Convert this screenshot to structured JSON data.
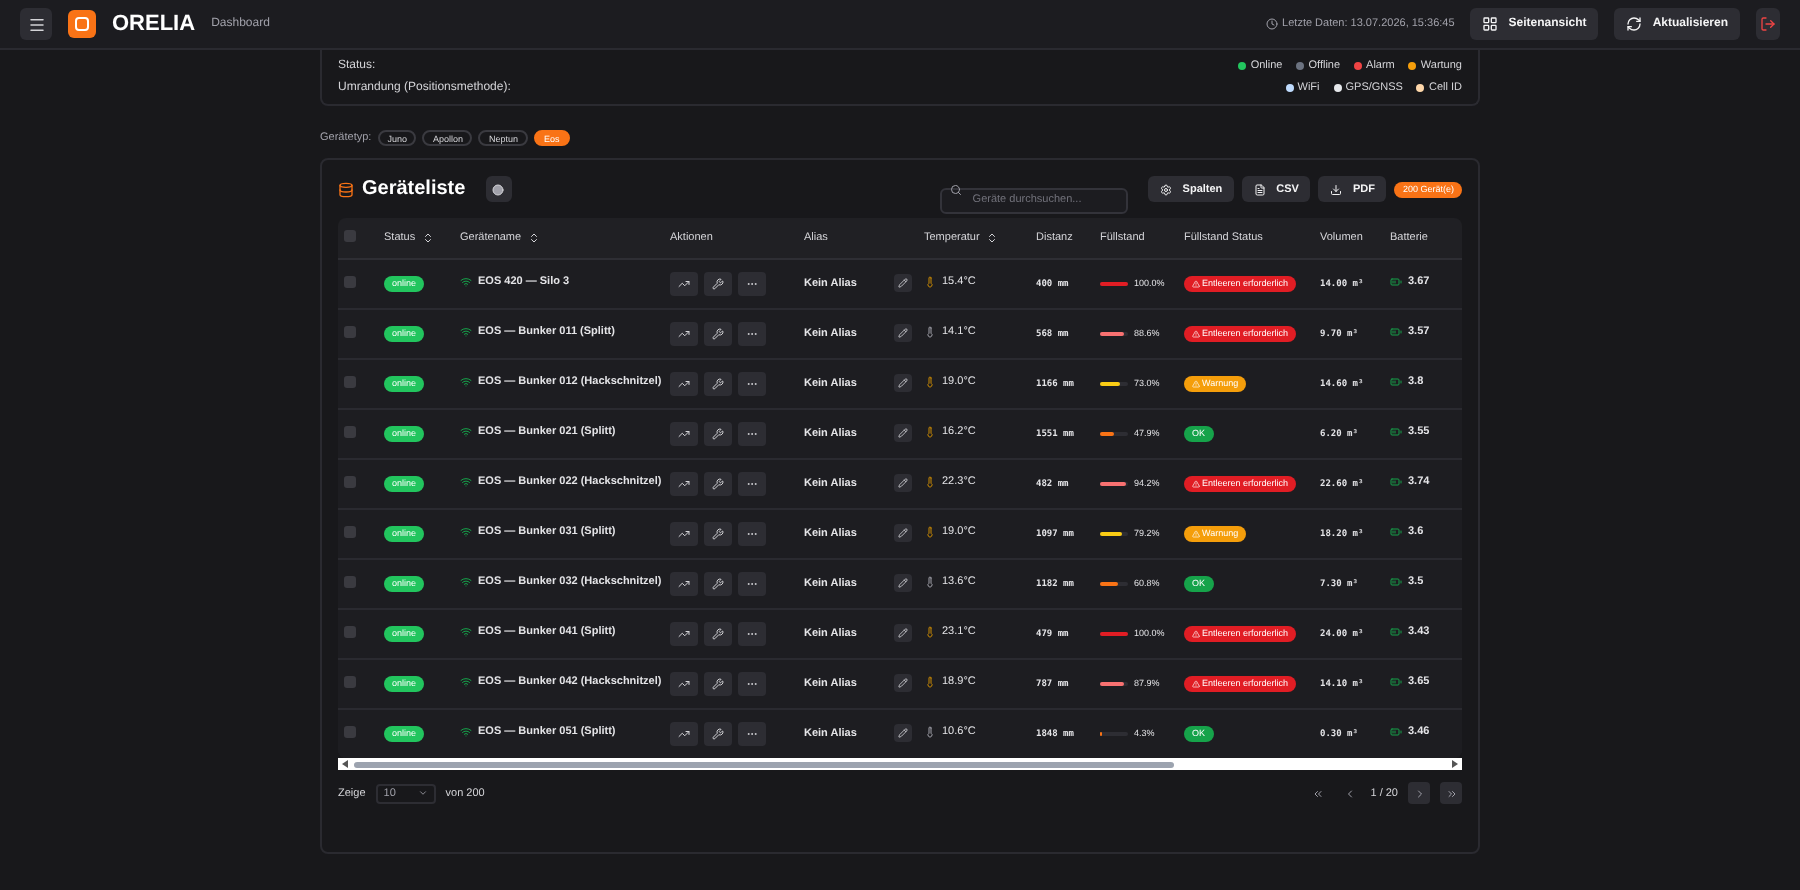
{
  "header": {
    "title": "ORELIA",
    "subtitle": "Dashboard",
    "last_update": "Letzte Daten: 13.07.2026, 15:36:45",
    "buttons": [
      {
        "label": "Seitenansicht",
        "kind": "layout"
      },
      {
        "label": "Aktualisieren",
        "kind": "refresh"
      }
    ]
  },
  "legend": {
    "status_label": "Status:",
    "status_items": [
      {
        "label": "Online",
        "color": "#22c55e"
      },
      {
        "label": "Offline",
        "color": "#6b7280"
      },
      {
        "label": "Alarm",
        "color": "#ef4444"
      },
      {
        "label": "Wartung",
        "color": "#f59e0b"
      }
    ],
    "border_label": "Umrandung (Positionsmethode):",
    "border_items": [
      {
        "label": "WiFi",
        "color": "#bfdbfe"
      },
      {
        "label": "GPS/GNSS",
        "color": "#e5e7eb"
      },
      {
        "label": "Cell ID",
        "color": "#fed7aa"
      }
    ]
  },
  "filter": {
    "label": "Gerätetyp:",
    "chips": [
      {
        "label": "Juno",
        "selected": false
      },
      {
        "label": "Apollon",
        "selected": false
      },
      {
        "label": "Neptun",
        "selected": false
      },
      {
        "label": "Eos",
        "selected": true
      }
    ]
  },
  "list": {
    "title": "Geräteliste",
    "search": {
      "placeholder": "Geräte durchsuchen..."
    },
    "buttons": [
      {
        "label": "Spalten",
        "kind": "columns"
      },
      {
        "label": "CSV",
        "kind": "file"
      },
      {
        "label": "PDF",
        "kind": "download"
      }
    ],
    "count": "200 Gerät(e)",
    "all_checked": false,
    "columns": [
      {
        "label": "Status",
        "sortable": true
      },
      {
        "label": "Gerätename",
        "sortable": true
      },
      {
        "label": "Aktionen",
        "sortable": false
      },
      {
        "label": "Alias",
        "sortable": false
      },
      {
        "label": "Temperatur",
        "sortable": true
      },
      {
        "label": "Distanz",
        "sortable": false
      },
      {
        "label": "Füllstand",
        "sortable": false
      },
      {
        "label": "Füllstand Status",
        "sortable": false
      },
      {
        "label": "Volumen",
        "sortable": false
      },
      {
        "label": "Batterie",
        "sortable": false
      }
    ],
    "rows": [
      {
        "checked": false,
        "status": "online",
        "name": "EOS 420 — Silo 3",
        "alias": "Kein Alias",
        "temperature": "15.4°C",
        "distance": "400 mm",
        "level": 1.0,
        "fill": "100.0%",
        "fill_status": {
          "label": "Entleeren erforderlich",
          "kind": "alarm"
        },
        "volume": "14.00 m³",
        "battery": "3.67"
      },
      {
        "checked": false,
        "status": "online",
        "name": "EOS — Bunker 011 (Splitt)",
        "alias": "Kein Alias",
        "temperature": "14.1°C",
        "distance": "568 mm",
        "level": 0.886,
        "fill": "88.6%",
        "fill_status": {
          "label": "Entleeren erforderlich",
          "kind": "alarm"
        },
        "volume": "9.70 m³",
        "battery": "3.57"
      },
      {
        "checked": false,
        "status": "online",
        "name": "EOS — Bunker 012 (Hackschnitzel)",
        "alias": "Kein Alias",
        "temperature": "19.0°C",
        "distance": "1166 mm",
        "level": 0.73,
        "fill": "73.0%",
        "fill_status": {
          "label": "Warnung",
          "kind": "warning"
        },
        "volume": "14.60 m³",
        "battery": "3.8"
      },
      {
        "checked": false,
        "status": "online",
        "name": "EOS — Bunker 021 (Splitt)",
        "alias": "Kein Alias",
        "temperature": "16.2°C",
        "distance": "1551 mm",
        "level": 0.479,
        "fill": "47.9%",
        "fill_status": {
          "label": "OK",
          "kind": "ok"
        },
        "volume": "6.20 m³",
        "battery": "3.55"
      },
      {
        "checked": false,
        "status": "online",
        "name": "EOS — Bunker 022 (Hackschnitzel)",
        "alias": "Kein Alias",
        "temperature": "22.3°C",
        "distance": "482 mm",
        "level": 0.942,
        "fill": "94.2%",
        "fill_status": {
          "label": "Entleeren erforderlich",
          "kind": "alarm"
        },
        "volume": "22.60 m³",
        "battery": "3.74"
      },
      {
        "checked": false,
        "status": "online",
        "name": "EOS — Bunker 031 (Splitt)",
        "alias": "Kein Alias",
        "temperature": "19.0°C",
        "distance": "1097 mm",
        "level": 0.792,
        "fill": "79.2%",
        "fill_status": {
          "label": "Warnung",
          "kind": "warning"
        },
        "volume": "18.20 m³",
        "battery": "3.6"
      },
      {
        "checked": false,
        "status": "online",
        "name": "EOS — Bunker 032 (Hackschnitzel)",
        "alias": "Kein Alias",
        "temperature": "13.6°C",
        "distance": "1182 mm",
        "level": 0.608,
        "fill": "60.8%",
        "fill_status": {
          "label": "OK",
          "kind": "ok"
        },
        "volume": "7.30 m³",
        "battery": "3.5"
      },
      {
        "checked": false,
        "status": "online",
        "name": "EOS — Bunker 041 (Splitt)",
        "alias": "Kein Alias",
        "temperature": "23.1°C",
        "distance": "479 mm",
        "level": 1.0,
        "fill": "100.0%",
        "fill_status": {
          "label": "Entleeren erforderlich",
          "kind": "alarm"
        },
        "volume": "24.00 m³",
        "battery": "3.43"
      },
      {
        "checked": false,
        "status": "online",
        "name": "EOS — Bunker 042 (Hackschnitzel)",
        "alias": "Kein Alias",
        "temperature": "18.9°C",
        "distance": "787 mm",
        "level": 0.879,
        "fill": "87.9%",
        "fill_status": {
          "label": "Entleeren erforderlich",
          "kind": "alarm"
        },
        "volume": "14.10 m³",
        "battery": "3.65"
      },
      {
        "checked": false,
        "status": "online",
        "name": "EOS — Bunker 051 (Splitt)",
        "alias": "Kein Alias",
        "temperature": "10.6°C",
        "distance": "1848 mm",
        "level": 0.043,
        "fill": "4.3%",
        "fill_status": {
          "label": "OK",
          "kind": "ok"
        },
        "volume": "0.30 m³",
        "battery": "3.46"
      }
    ],
    "pagination": {
      "show_label": "Zeige",
      "page_size": "10",
      "total": "von 200",
      "page": "1 / 20"
    }
  }
}
